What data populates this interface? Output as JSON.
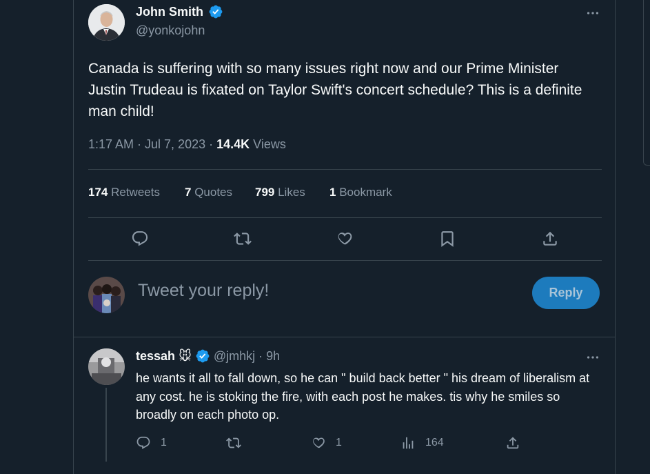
{
  "tweet": {
    "author_name": "John Smith",
    "author_handle": "@yonkojohn",
    "text": "Canada is suffering with so many issues right now and our Prime Minister Justin Trudeau is fixated on Taylor Swift's concert schedule? This is a definite man child!",
    "time": "1:17 AM · Jul 7, 2023 · ",
    "views_count": "14.4K",
    "views_label": " Views",
    "stats": {
      "retweets_count": "174",
      "retweets_label": " Retweets",
      "quotes_count": "7",
      "quotes_label": " Quotes",
      "likes_count": "799",
      "likes_label": " Likes",
      "bookmarks_count": "1",
      "bookmarks_label": " Bookmark"
    }
  },
  "composer": {
    "placeholder": "Tweet your reply!",
    "button_label": "Reply"
  },
  "reply": {
    "author_name": "tessah",
    "emoji": "🐭",
    "author_handle": "@jmhkj",
    "sep": " · ",
    "time": "9h",
    "text": "he wants it all to fall down, so he can \" build back better \" his dream of liberalism at any cost. he is stoking the fire, with each post he makes. tis why he smiles so broadly on each photo op.",
    "replies": "1",
    "likes": "1",
    "views": "164"
  },
  "colors": {
    "background": "#15202b",
    "accent": "#1d9bf0",
    "muted": "#8b98a5",
    "reply_button": "#1d7bbd"
  },
  "icons": [
    "more-icon",
    "verified-icon",
    "reply-icon",
    "retweet-icon",
    "like-icon",
    "bookmark-icon",
    "share-icon",
    "views-icon"
  ]
}
